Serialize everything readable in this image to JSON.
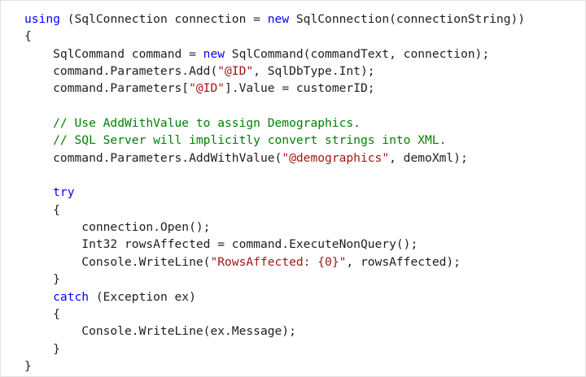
{
  "code_block": {
    "language": "csharp",
    "lines": [
      [
        [
          "kw",
          "using"
        ],
        [
          "plain",
          " (SqlConnection connection = "
        ],
        [
          "kw",
          "new"
        ],
        [
          "plain",
          " SqlConnection(connectionString))"
        ]
      ],
      [
        [
          "plain",
          "{"
        ]
      ],
      [
        [
          "plain",
          "    SqlCommand command = "
        ],
        [
          "kw",
          "new"
        ],
        [
          "plain",
          " SqlCommand(commandText, connection);"
        ]
      ],
      [
        [
          "plain",
          "    command.Parameters.Add("
        ],
        [
          "str",
          "\"@ID\""
        ],
        [
          "plain",
          ", SqlDbType.Int);"
        ]
      ],
      [
        [
          "plain",
          "    command.Parameters["
        ],
        [
          "str",
          "\"@ID\""
        ],
        [
          "plain",
          "].Value = customerID;"
        ]
      ],
      [],
      [
        [
          "comment",
          "    // Use AddWithValue to assign Demographics."
        ]
      ],
      [
        [
          "comment",
          "    // SQL Server will implicitly convert strings into XML."
        ]
      ],
      [
        [
          "plain",
          "    command.Parameters.AddWithValue("
        ],
        [
          "str",
          "\"@demographics\""
        ],
        [
          "plain",
          ", demoXml);"
        ]
      ],
      [],
      [
        [
          "kw",
          "    try"
        ]
      ],
      [
        [
          "plain",
          "    {"
        ]
      ],
      [
        [
          "plain",
          "        connection.Open();"
        ]
      ],
      [
        [
          "plain",
          "        Int32 rowsAffected = command.ExecuteNonQuery();"
        ]
      ],
      [
        [
          "plain",
          "        Console.WriteLine("
        ],
        [
          "str",
          "\"RowsAffected: {0}\""
        ],
        [
          "plain",
          ", rowsAffected);"
        ]
      ],
      [
        [
          "plain",
          "    }"
        ]
      ],
      [
        [
          "kw",
          "    catch"
        ],
        [
          "plain",
          " (Exception ex)"
        ]
      ],
      [
        [
          "plain",
          "    {"
        ]
      ],
      [
        [
          "plain",
          "        Console.WriteLine(ex.Message);"
        ]
      ],
      [
        [
          "plain",
          "    }"
        ]
      ],
      [
        [
          "plain",
          "}"
        ]
      ]
    ]
  },
  "colors": {
    "background": "#ffffff",
    "keyword": "#0101fd",
    "string": "#a31515",
    "comment": "#008000",
    "plain": "#1e1e1e",
    "border": "#e3e3e3"
  }
}
